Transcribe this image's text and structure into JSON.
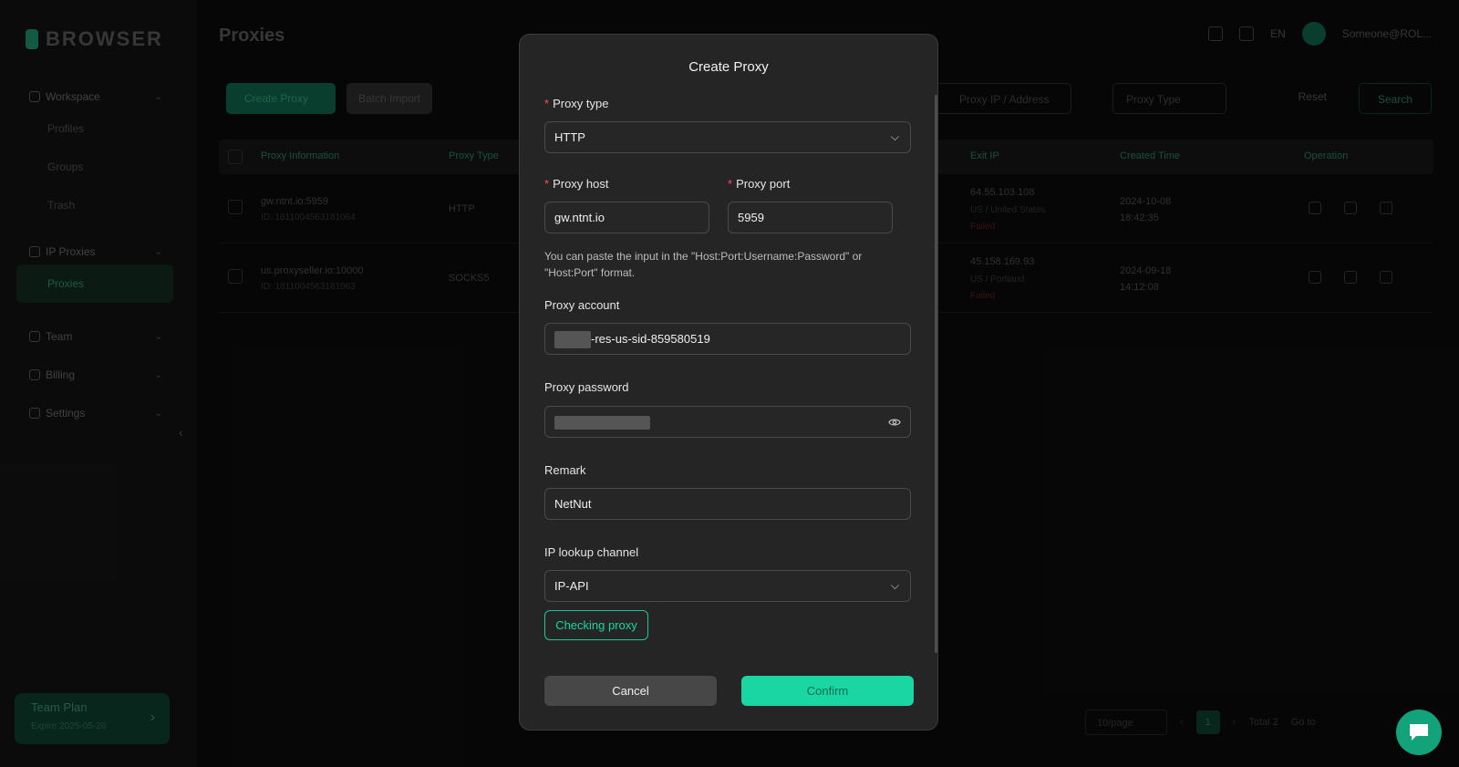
{
  "app": {
    "logo_text": "BROWSER",
    "page_title": "Proxies",
    "top_right": {
      "language": "EN",
      "username": "Someone@ROL..."
    },
    "sidebar": {
      "groups": [
        {
          "label": "Workspace",
          "subs": [
            "Profiles",
            "Groups",
            "Trash"
          ]
        },
        {
          "label": "IP Proxies",
          "subs": [
            "Proxies"
          ]
        },
        {
          "label": "Team",
          "subs": []
        },
        {
          "label": "Billing",
          "subs": []
        },
        {
          "label": "Settings",
          "subs": []
        }
      ],
      "team_plan": {
        "title": "Team Plan",
        "expiry": "Expire 2025-05-26"
      }
    },
    "toolbar": {
      "create_label": "Create Proxy",
      "import_label": "Batch Import",
      "search_placeholder": "Proxy IP / Address",
      "filter_placeholder": "Proxy Type",
      "reset_label": "Reset",
      "search_label": "Search"
    },
    "table": {
      "headers": [
        "Proxy Information",
        "Proxy Type",
        "Exit IP",
        "Created Time",
        "Operation"
      ],
      "rows": [
        {
          "info": "gw.ntnt.io:5959",
          "sub": "ID: 1811004563181064",
          "type": "HTTP",
          "ip": "64.55.103.108",
          "loc": "US / United States",
          "status": "Failed",
          "time": "2024-10-08",
          "time2": "18:42:35"
        },
        {
          "info": "us.proxyseller.io:10000",
          "sub": "ID: 1811004563181063",
          "type": "SOCKS5",
          "ip": "45.158.169.93",
          "loc": "US / Portland",
          "status": "Failed",
          "time": "2024-09-18",
          "time2": "14:12:08"
        }
      ]
    },
    "pager": {
      "size": "10/page",
      "page": "1",
      "total": "Total 2",
      "goto": "Go to"
    }
  },
  "modal": {
    "title": "Create Proxy",
    "proxy_type": {
      "label": "Proxy type",
      "value": "HTTP"
    },
    "proxy_host": {
      "label": "Proxy host",
      "value": "gw.ntnt.io"
    },
    "proxy_port": {
      "label": "Proxy port",
      "value": "5959"
    },
    "hint": "You can paste the input in the \"Host:Port:Username:Password\" or \"Host:Port\" format.",
    "proxy_account": {
      "label": "Proxy account",
      "value_suffix": "-res-us-sid-859580519"
    },
    "proxy_password": {
      "label": "Proxy password"
    },
    "remark": {
      "label": "Remark",
      "value": "NetNut"
    },
    "ip_lookup": {
      "label": "IP lookup channel",
      "value": "IP-API"
    },
    "check_label": "Checking proxy",
    "cancel_label": "Cancel",
    "confirm_label": "Confirm"
  },
  "colors": {
    "accent": "#1ad6a2",
    "required": "#ff4d4f",
    "modal_bg": "#252525"
  },
  "icons": [
    "chevron-down-icon",
    "eye-icon",
    "chat-icon"
  ]
}
